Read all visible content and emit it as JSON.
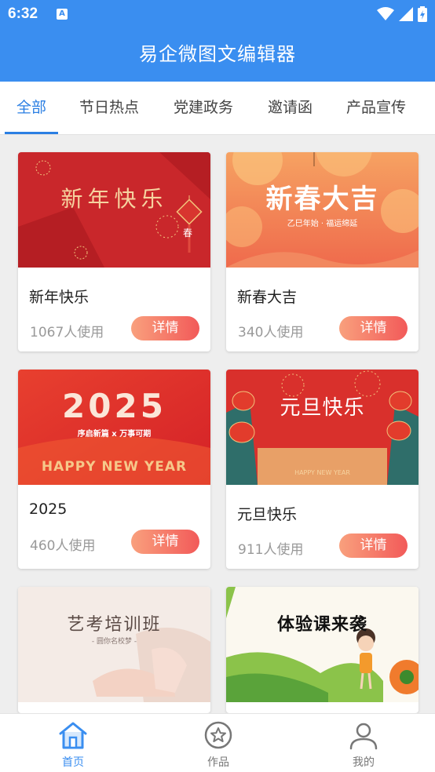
{
  "status": {
    "time": "6:32",
    "notif_letter": "A"
  },
  "app": {
    "title": "易企微图文编辑器"
  },
  "tabs": [
    {
      "label": "全部",
      "active": true
    },
    {
      "label": "节日热点",
      "active": false
    },
    {
      "label": "党建政务",
      "active": false
    },
    {
      "label": "邀请函",
      "active": false
    },
    {
      "label": "产品宣传",
      "active": false
    }
  ],
  "cards": [
    {
      "title": "新年快乐",
      "uses": "1067人使用",
      "button": "详情",
      "image": {
        "headline": "新年快乐",
        "badge": "春"
      }
    },
    {
      "title": "新春大吉",
      "uses": "340人使用",
      "button": "详情",
      "image": {
        "headline": "新春大吉",
        "subline": "乙巳年始 · 福运绵延"
      }
    },
    {
      "title": "2025",
      "uses": "460人使用",
      "button": "详情",
      "image": {
        "headline": "2025",
        "subline": "序启新篇 x 万事可期",
        "english": "HAPPY NEW YEAR"
      }
    },
    {
      "title": "元旦快乐",
      "uses": "911人使用",
      "button": "详情",
      "image": {
        "headline": "元旦快乐",
        "english": "HAPPY NEW YEAR"
      }
    },
    {
      "title": "",
      "uses": "",
      "button": "",
      "image": {
        "headline": "艺考培训班",
        "subline": "- 圆你名校梦 -"
      }
    },
    {
      "title": "",
      "uses": "",
      "button": "",
      "image": {
        "headline": "体验课来袭"
      }
    }
  ],
  "bottom_nav": [
    {
      "label": "首页",
      "icon": "home-icon",
      "active": true
    },
    {
      "label": "作品",
      "icon": "star-icon",
      "active": false
    },
    {
      "label": "我的",
      "icon": "user-icon",
      "active": false
    }
  ],
  "colors": {
    "primary": "#3a8ef0",
    "tab_active": "#2b7fe3",
    "button_start": "#f9a07d",
    "button_end": "#f25a59"
  }
}
